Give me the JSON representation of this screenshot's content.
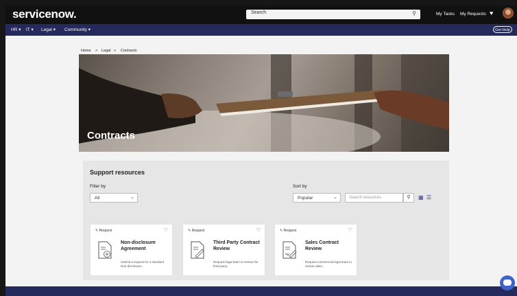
{
  "topbar": {
    "logo": "servicenow.",
    "search_placeholder": "Search",
    "my_tasks": "My Tasks",
    "my_requests": "My Requests"
  },
  "subnav": {
    "items": [
      "HR",
      "IT",
      "Legal",
      "Community"
    ],
    "get_help": "Get Help"
  },
  "breadcrumb": {
    "home": "Home",
    "legal": "Legal",
    "current": "Contracts"
  },
  "hero": {
    "title": "Contracts"
  },
  "resources": {
    "title": "Support resources",
    "filter_label": "Filter by",
    "filter_value": "All",
    "sort_label": "Sort by",
    "sort_value": "Popular",
    "search_placeholder": "Search resources"
  },
  "cards": [
    {
      "tag": "Request",
      "title": "Non-disclosure Agreement",
      "desc": "Submit a request for a standard Non-disclosure..."
    },
    {
      "tag": "Request",
      "title": "Third Party Contract Review",
      "desc": "Request legal team to review the third party..."
    },
    {
      "tag": "Request",
      "title": "Sales Contract Review",
      "desc": "Request commercial legal team to review sales..."
    }
  ],
  "colors": {
    "nav": "#242a5c",
    "topbar": "#111111",
    "accent": "#3f63c7"
  },
  "icons": [
    "search-icon",
    "heart-icon",
    "grid-view-icon",
    "list-view-icon",
    "edit-icon",
    "favorite-icon",
    "chat-icon"
  ]
}
